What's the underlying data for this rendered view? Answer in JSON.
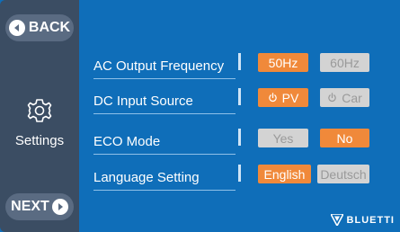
{
  "sidebar": {
    "back_label": "BACK",
    "next_label": "NEXT",
    "settings_label": "Settings"
  },
  "settings": [
    {
      "label": "AC Output Frequency",
      "options": [
        {
          "label": "50Hz",
          "active": true
        },
        {
          "label": "60Hz",
          "active": false
        }
      ]
    },
    {
      "label": "DC Input Source",
      "options": [
        {
          "label": "PV",
          "active": true,
          "icon": "power-icon"
        },
        {
          "label": "Car",
          "active": false,
          "icon": "power-icon"
        }
      ]
    },
    {
      "label": "ECO Mode",
      "options": [
        {
          "label": "Yes",
          "active": false
        },
        {
          "label": "No",
          "active": true
        }
      ]
    },
    {
      "label": "Language Setting",
      "options": [
        {
          "label": "English",
          "active": true
        },
        {
          "label": "Deutsch",
          "active": false
        }
      ]
    }
  ],
  "brand": "BLUETTI",
  "colors": {
    "background": "#0f6eb9",
    "sidebar": "#3b4d63",
    "button": "#5a6b82",
    "active": "#f0893a",
    "inactive": "#d3d3d3"
  }
}
